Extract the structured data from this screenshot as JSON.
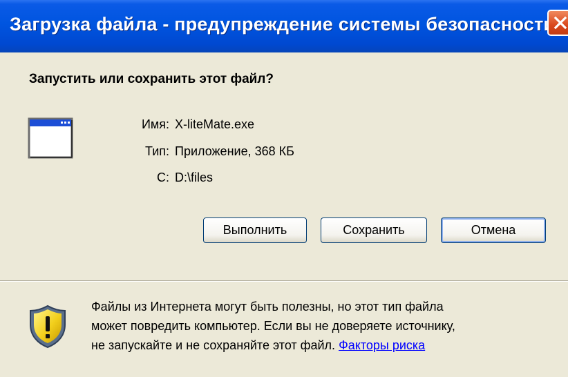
{
  "window": {
    "title": "Загрузка файла - предупреждение системы безопасности"
  },
  "dialog": {
    "question": "Запустить или сохранить этот файл?",
    "file": {
      "name_label": "Имя:",
      "name_value": "X-liteMate.exe",
      "type_label": "Тип:",
      "type_value": "Приложение, 368 КБ",
      "from_label": "С:",
      "from_value": "D:\\files"
    },
    "buttons": {
      "run": "Выполнить",
      "save": "Сохранить",
      "cancel": "Отмена"
    },
    "warning": {
      "line1": "Файлы из Интернета могут быть полезны, но этот тип файла",
      "line2": "может повредить компьютер. Если вы не доверяете источнику,",
      "line3": "не запускайте и не сохраняйте этот файл. ",
      "link": "Факторы риска"
    }
  },
  "icons": {
    "close": "close-icon",
    "application": "application-window-icon",
    "warning": "security-shield-icon"
  },
  "colors": {
    "titlebar": "#0055e0",
    "close_button": "#d9481d",
    "dialog_background": "#ece9d8",
    "button_border": "#003c74",
    "link": "#0000ff"
  }
}
